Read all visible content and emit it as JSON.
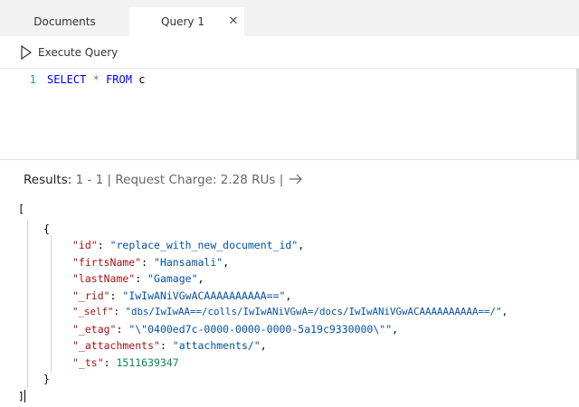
{
  "tabs": [
    {
      "label": "Documents",
      "active": false
    },
    {
      "label": "Query 1",
      "active": true,
      "close": "✕"
    }
  ],
  "toolbar": {
    "execute_label": "Execute Query"
  },
  "editor": {
    "line_number": "1",
    "tokens": {
      "select": "SELECT",
      "star": "*",
      "from": "FROM",
      "ident": "c"
    }
  },
  "results": {
    "label": "Results:",
    "range": "1 - 1",
    "sep1": "|",
    "charge": "Request Charge: 2.28 RUs",
    "sep2": "|",
    "next_icon": "arrow-right-icon"
  },
  "json": {
    "open_array": "[",
    "open_obj": "{",
    "fields": [
      {
        "key": "\"id\"",
        "value": "\"replace_with_new_document_id\"",
        "type": "str",
        "comma": ","
      },
      {
        "key": "\"firtsName\"",
        "value": "\"Hansamali\"",
        "type": "str",
        "comma": ","
      },
      {
        "key": "\"lastName\"",
        "value": "\"Gamage\"",
        "type": "str",
        "comma": ","
      },
      {
        "key": "\"_rid\"",
        "value": "\"IwIwANiVGwACAAAAAAAAAA==\"",
        "type": "str",
        "comma": ","
      },
      {
        "key": "\"_self\"",
        "value": "\"dbs/IwIwAA==/colls/IwIwANiVGwA=/docs/IwIwANiVGwACAAAAAAAAAA==/\"",
        "type": "str",
        "comma": ","
      },
      {
        "key": "\"_etag\"",
        "value": "\"\\\"0400ed7c-0000-0000-0000-5a19c9330000\\\"\"",
        "type": "str",
        "comma": ","
      },
      {
        "key": "\"_attachments\"",
        "value": "\"attachments/\"",
        "type": "str",
        "comma": ","
      },
      {
        "key": "\"_ts\"",
        "value": "1511639347",
        "type": "num",
        "comma": ""
      }
    ],
    "close_obj": "}",
    "close_array": "]"
  },
  "colors": {
    "keyword": "#0000ff",
    "key": "#a31515",
    "string": "#0451a5",
    "number": "#098658"
  }
}
